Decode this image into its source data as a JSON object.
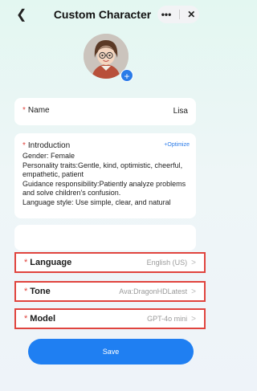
{
  "header": {
    "title": "Custom Character",
    "back_icon": "chevron-left-icon",
    "more_icon": "more-icon",
    "close_icon": "close-icon"
  },
  "avatar": {
    "add_icon": "plus-icon"
  },
  "name_field": {
    "label": "Name",
    "required_mark": "*",
    "value": "Lisa"
  },
  "introduction": {
    "label": "Introduction",
    "required_mark": "*",
    "optimize_label": "Optimize",
    "optimize_icon": "sparkle-icon",
    "text": "Gender: Female\nPersonality traits:Gentle, kind, optimistic, cheerful, empathetic, patient\nGuidance responsibility:Patiently analyze problems and solve children's confusion.\nLanguage style: Use simple, clear, and natural"
  },
  "settings": [
    {
      "label": "Language",
      "required_mark": "*",
      "value": "English (US)"
    },
    {
      "label": "Tone",
      "required_mark": "*",
      "value": "Ava:DragonHDLatest"
    },
    {
      "label": "Model",
      "required_mark": "*",
      "value": "GPT-4o mini"
    }
  ],
  "save_button": {
    "label": "Save"
  },
  "colors": {
    "accent": "#1f7ff2",
    "required": "#e0443e",
    "highlight_border": "#e0443e"
  }
}
